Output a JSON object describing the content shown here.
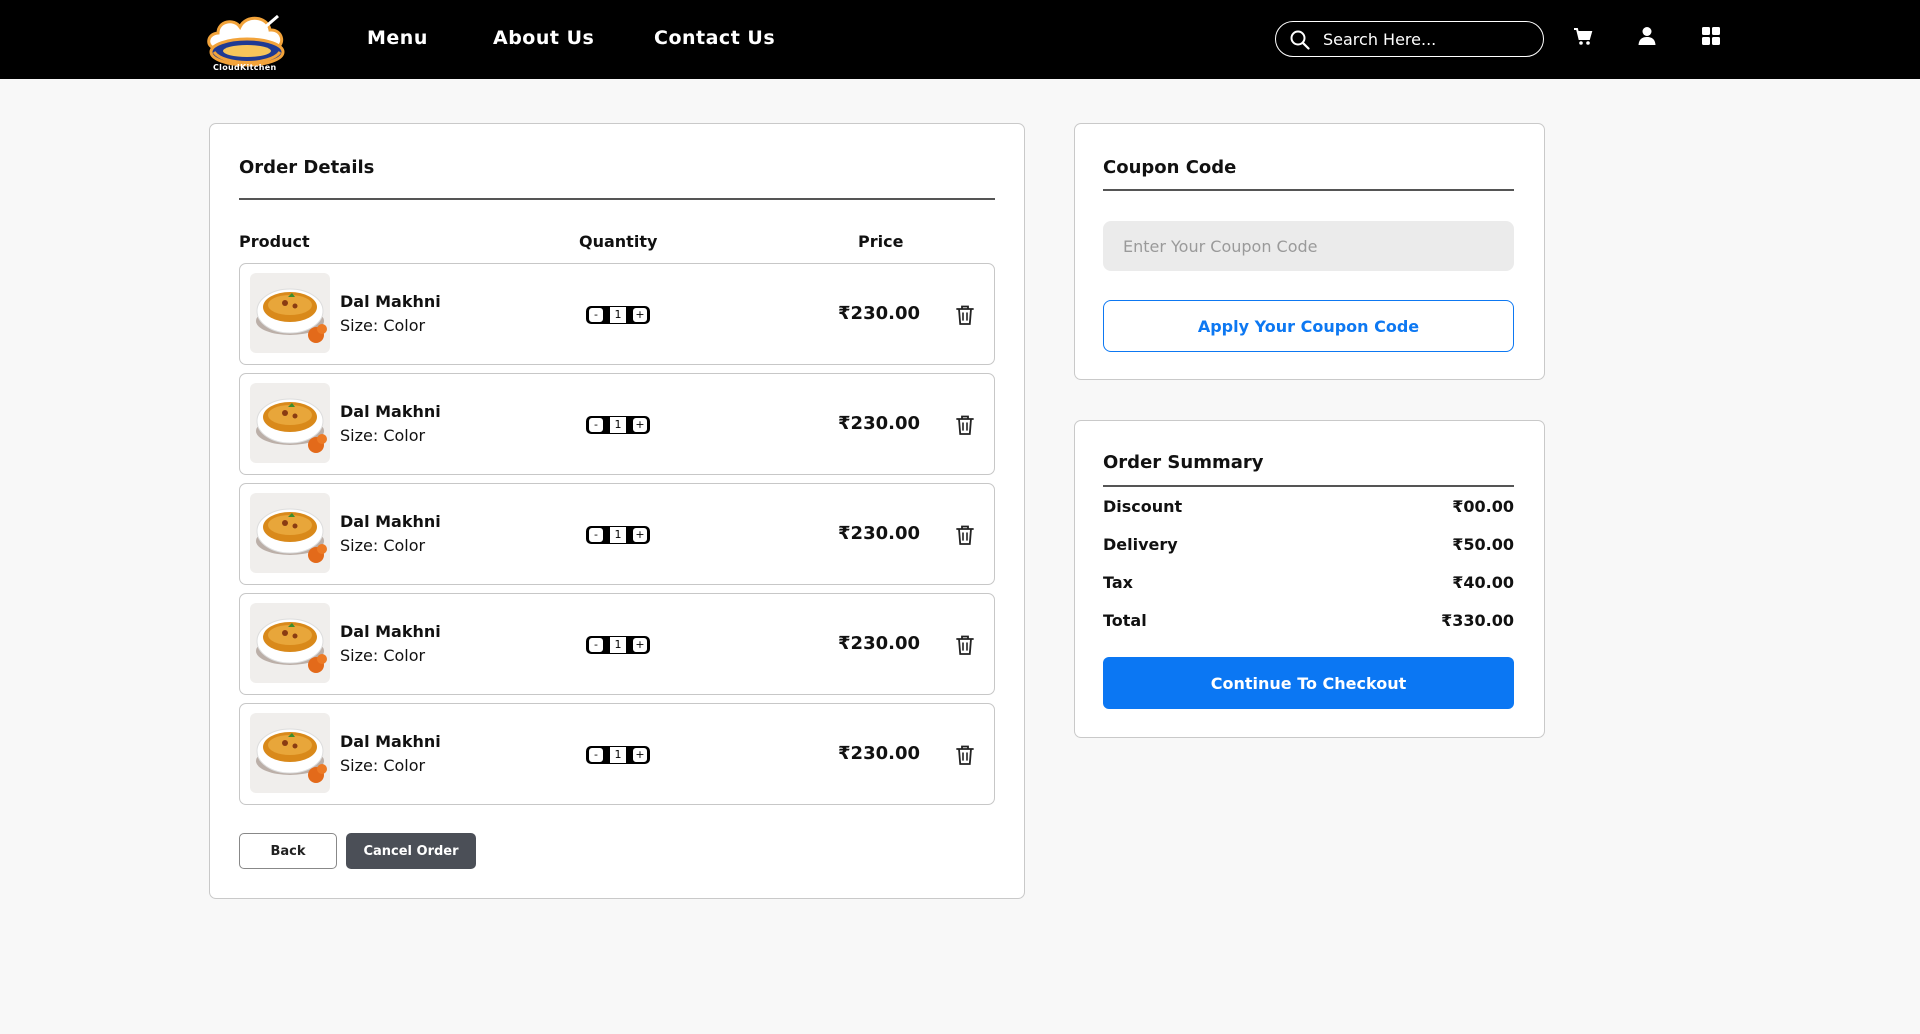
{
  "nav": {
    "brand": "CloudKitchen",
    "links": [
      "Menu",
      "About Us",
      "Contact Us"
    ],
    "search_placeholder": "Search Here...",
    "icons": [
      "cart-icon",
      "user-icon",
      "grid-icon"
    ]
  },
  "order": {
    "title": "Order Details",
    "columns": {
      "product": "Product",
      "quantity": "Quantity",
      "price": "Price"
    },
    "items": [
      {
        "name": "Dal Makhni",
        "size": "Size: Color",
        "qty": "1",
        "price": "₹230.00"
      },
      {
        "name": "Dal Makhni",
        "size": "Size: Color",
        "qty": "1",
        "price": "₹230.00"
      },
      {
        "name": "Dal Makhni",
        "size": "Size: Color",
        "qty": "1",
        "price": "₹230.00"
      },
      {
        "name": "Dal Makhni",
        "size": "Size: Color",
        "qty": "1",
        "price": "₹230.00"
      },
      {
        "name": "Dal Makhni",
        "size": "Size: Color",
        "qty": "1",
        "price": "₹230.00"
      }
    ],
    "qty_minus": "-",
    "qty_plus": "+",
    "back_label": "Back",
    "cancel_label": "Cancel Order"
  },
  "coupon": {
    "title": "Coupon Code",
    "placeholder": "Enter Your Coupon Code",
    "apply_label": "Apply Your Coupon Code"
  },
  "summary": {
    "title": "Order Summary",
    "rows": [
      {
        "label": "Discount",
        "value": "₹00.00"
      },
      {
        "label": "Delivery",
        "value": "₹50.00"
      },
      {
        "label": "Tax",
        "value": "₹40.00"
      },
      {
        "label": "Total",
        "value": "₹330.00"
      }
    ],
    "checkout_label": "Continue To Checkout"
  },
  "colors": {
    "nav_bg": "#000000",
    "accent": "#0b77f3",
    "cancel_bg": "#4b4f57",
    "page_bg": "#f8f8f8"
  }
}
